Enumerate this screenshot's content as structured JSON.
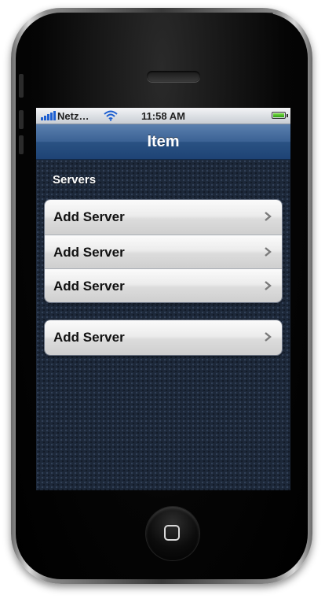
{
  "status_bar": {
    "carrier": "Netz…",
    "time": "11:58 AM",
    "battery_level": 1.0
  },
  "nav_bar": {
    "title": "Item"
  },
  "section": {
    "header": "Servers"
  },
  "groups": [
    {
      "rows": [
        {
          "label": "Add Server"
        },
        {
          "label": "Add Server"
        },
        {
          "label": "Add Server"
        }
      ]
    },
    {
      "rows": [
        {
          "label": "Add Server"
        }
      ]
    }
  ],
  "icons": {
    "signal": "signal-bars-icon",
    "wifi": "wifi-icon",
    "battery": "battery-icon",
    "chevron": "chevron-right-icon",
    "home": "home-square-icon"
  },
  "colors": {
    "nav_bar": "#2a5283",
    "background": "#1d2839",
    "wifi": "#1d5fd1",
    "battery_fill": "#2e9e12"
  }
}
